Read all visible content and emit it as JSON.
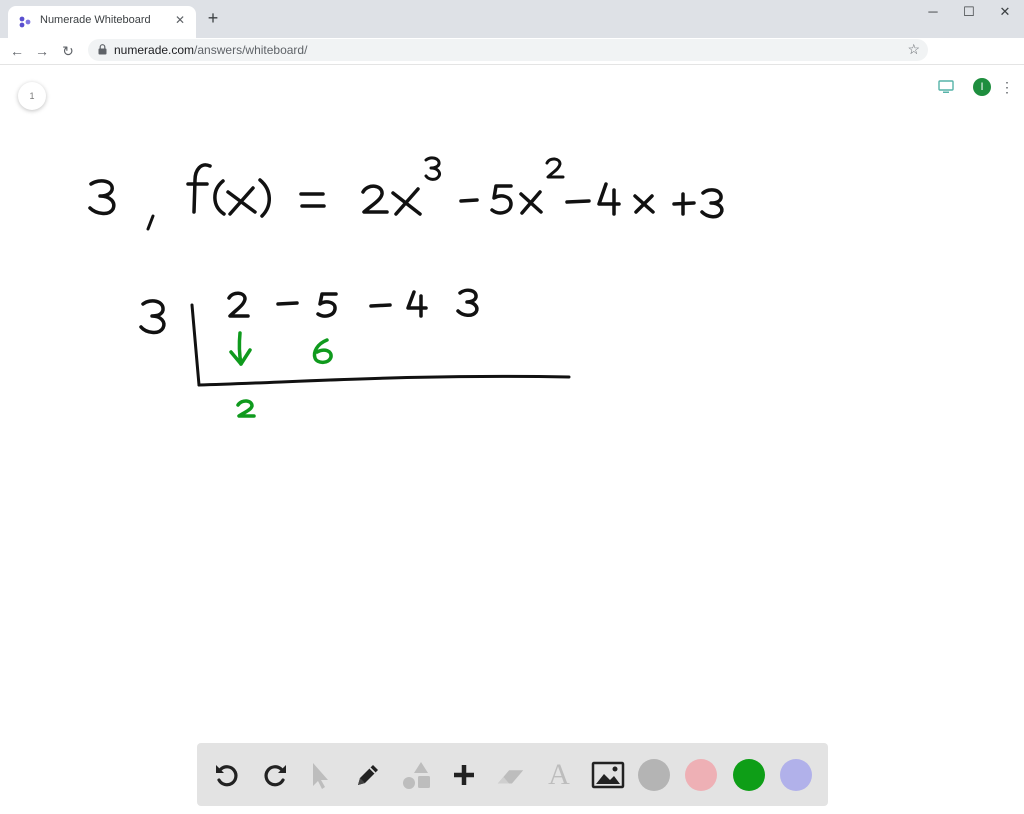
{
  "browser": {
    "tab_title": "Numerade Whiteboard",
    "tab_close": "✕",
    "new_tab": "+",
    "url_host": "numerade.com",
    "url_path": "/answers/whiteboard/",
    "profile_initial": "I",
    "window_controls": {
      "minimize": "─",
      "maximize": "☐",
      "close": "✕"
    },
    "nav": {
      "back": "←",
      "forward": "→",
      "reload": "↻",
      "star": "☆",
      "menu": "⋮"
    }
  },
  "whiteboard": {
    "page_number": "1",
    "ink_colors": {
      "black": "#111111",
      "green": "#0f9a1d"
    },
    "handwriting": {
      "problem_number": "3",
      "function": "f(x)",
      "equals": "=",
      "polynomial_terms": [
        "2x³",
        "−",
        "5x²",
        "−",
        "4x",
        "+",
        "3"
      ],
      "synthetic_divisor": "3",
      "coefficients": [
        "2",
        "−5",
        "−4",
        "3"
      ],
      "green_down_arrow": "↓",
      "green_product": "6",
      "green_result": "2"
    }
  },
  "palette": {
    "tools": [
      "undo-icon",
      "redo-icon",
      "pointer-icon",
      "pencil-icon",
      "shapes-icon",
      "plus-icon",
      "eraser-icon",
      "text-icon",
      "image-icon"
    ],
    "text_tool_label": "A",
    "colors": [
      "#b4b4b4",
      "#eeb0b5",
      "#0e9e17",
      "#b1b1ea"
    ]
  }
}
